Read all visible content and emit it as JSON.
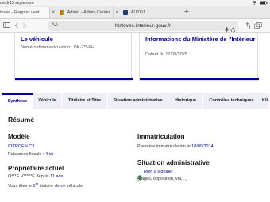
{
  "browser": {
    "status_time": "medi 13 septembre",
    "tabs": [
      {
        "label": "tovec - Rapport vent…",
        "close": "✕"
      },
      {
        "label": "Admin - Admin Center",
        "close": "✕"
      },
      {
        "label": "AUTO1",
        "close": "✕"
      }
    ],
    "new_tab": "+",
    "url": "histovec.interieur.gouv.fr",
    "reader_icon": "AA"
  },
  "cards": {
    "vehicle": {
      "title": "Le véhicule",
      "subtitle": "Numéro d'immatriculation : DK-2**-EH"
    },
    "ministry": {
      "title": "Informations du Ministère de l'Intérieur",
      "subtitle": "Datant du 12/09/2025"
    }
  },
  "tabs": [
    "Synthèse",
    "Véhicule",
    "Titulaire et Titre",
    "Situation administrative",
    "Historique",
    "Contrôles techniques",
    "Kil"
  ],
  "resume": {
    "heading": "Résumé",
    "modele": {
      "heading": "Modèle",
      "value": "CITROEN C3",
      "power_label": "Puissance fiscale : ",
      "power_value": "4 ch"
    },
    "immatriculation": {
      "heading": "Immatriculation",
      "label": "Première immatriculation le ",
      "date": "18/09/2014"
    },
    "proprietaire": {
      "heading": "Propriétaire actuel",
      "name": "Q***E V*****E depuis ",
      "since": "11 ans",
      "line2_a": "Vous êtes le ",
      "line2_b": "1",
      "line2_sup": "er",
      "line2_c": " titulaire de ce véhicule"
    },
    "situation": {
      "heading": "Situation administrative",
      "status": "Rien à signaler",
      "detail": "(gages, opposition, vol,...)"
    }
  },
  "colors": {
    "accent": "#000091",
    "success": "#18753c"
  }
}
